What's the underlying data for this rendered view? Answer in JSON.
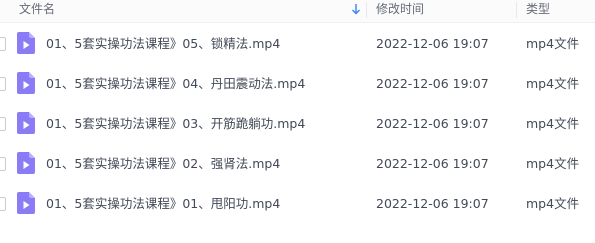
{
  "header": {
    "name_label": "文件名",
    "mtime_label": "修改时间",
    "type_label": "类型",
    "sort_icon": "arrow-down-icon",
    "accent_color": "#3b82f6"
  },
  "files": [
    {
      "name": "01、5套实操功法课程》05、锁精法.mp4",
      "mtime": "2022-12-06 19:07",
      "type": "mp4文件",
      "icon": "video-file-icon"
    },
    {
      "name": "01、5套实操功法课程》04、丹田震动法.mp4",
      "mtime": "2022-12-06 19:07",
      "type": "mp4文件",
      "icon": "video-file-icon"
    },
    {
      "name": "01、5套实操功法课程》03、开筋跪躺功.mp4",
      "mtime": "2022-12-06 19:07",
      "type": "mp4文件",
      "icon": "video-file-icon"
    },
    {
      "name": "01、5套实操功法课程》02、强肾法.mp4",
      "mtime": "2022-12-06 19:07",
      "type": "mp4文件",
      "icon": "video-file-icon"
    },
    {
      "name": "01、5套实操功法课程》01、甩阳功.mp4",
      "mtime": "2022-12-06 19:07",
      "type": "mp4文件",
      "icon": "video-file-icon"
    }
  ],
  "icon_color": "#8b7cf6"
}
